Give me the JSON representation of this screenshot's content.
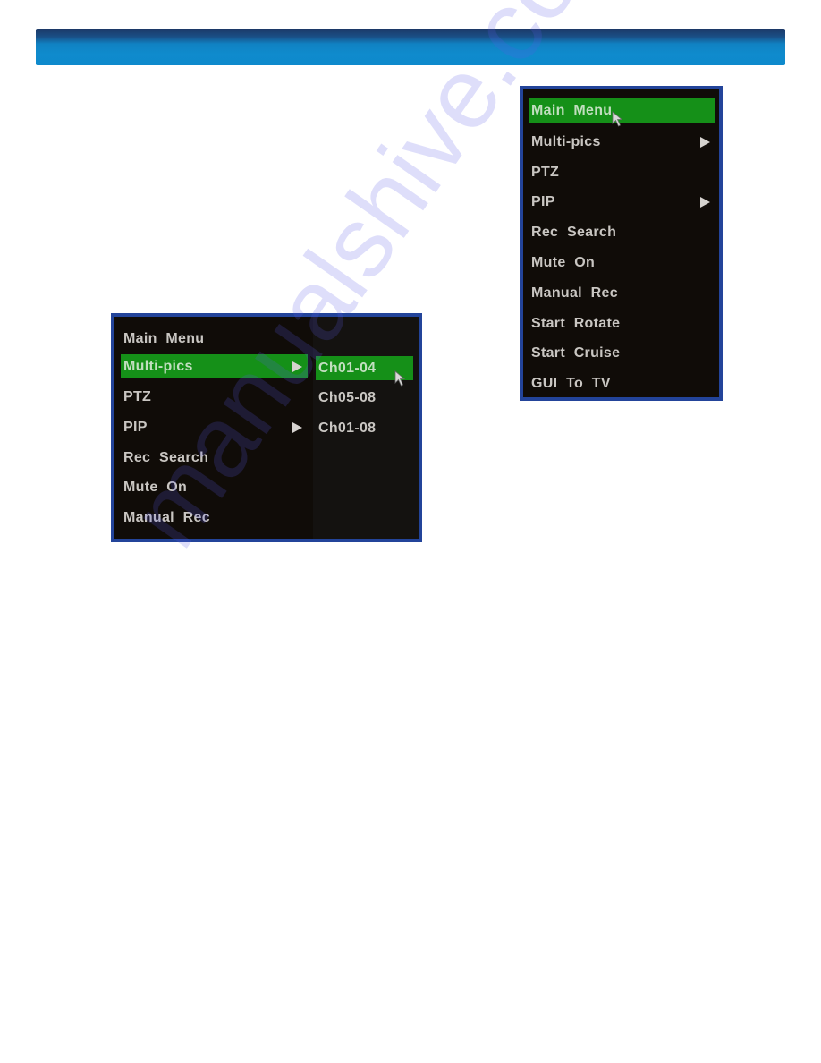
{
  "header": {
    "gradient_top": "#1c3866",
    "gradient_bottom": "#0e89cc"
  },
  "colors": {
    "menu_border": "#23449a",
    "menu_background": "#100c08",
    "highlight": "#159018",
    "menu_text": "#c9c6c2",
    "highlight_text": "#c2dfc0"
  },
  "left_menu": {
    "items": [
      {
        "label": "Main Menu",
        "has_submenu": false,
        "selected": false
      },
      {
        "label": "Multi-pics",
        "has_submenu": true,
        "selected": true
      },
      {
        "label": "PTZ",
        "has_submenu": false,
        "selected": false
      },
      {
        "label": "PIP",
        "has_submenu": true,
        "selected": false
      },
      {
        "label": "Rec Search",
        "has_submenu": false,
        "selected": false
      },
      {
        "label": "Mute On",
        "has_submenu": false,
        "selected": false
      },
      {
        "label": "Manual Rec",
        "has_submenu": false,
        "selected": false
      }
    ],
    "submenu": {
      "parent": "Multi-pics",
      "items": [
        {
          "label": "Ch01-04",
          "selected": true
        },
        {
          "label": "Ch05-08",
          "selected": false
        },
        {
          "label": "Ch01-08",
          "selected": false
        }
      ]
    }
  },
  "right_menu": {
    "items": [
      {
        "label": "Main Menu",
        "has_submenu": false,
        "selected": true
      },
      {
        "label": "Multi-pics",
        "has_submenu": true,
        "selected": false
      },
      {
        "label": "PTZ",
        "has_submenu": false,
        "selected": false
      },
      {
        "label": "PIP",
        "has_submenu": true,
        "selected": false
      },
      {
        "label": "Rec Search",
        "has_submenu": false,
        "selected": false
      },
      {
        "label": "Mute On",
        "has_submenu": false,
        "selected": false
      },
      {
        "label": "Manual Rec",
        "has_submenu": false,
        "selected": false
      },
      {
        "label": "Start Rotate",
        "has_submenu": false,
        "selected": false
      },
      {
        "label": "Start Cruise",
        "has_submenu": false,
        "selected": false
      },
      {
        "label": "GUI To TV",
        "has_submenu": false,
        "selected": false
      }
    ]
  },
  "watermark": {
    "text": "manualshive.com"
  }
}
